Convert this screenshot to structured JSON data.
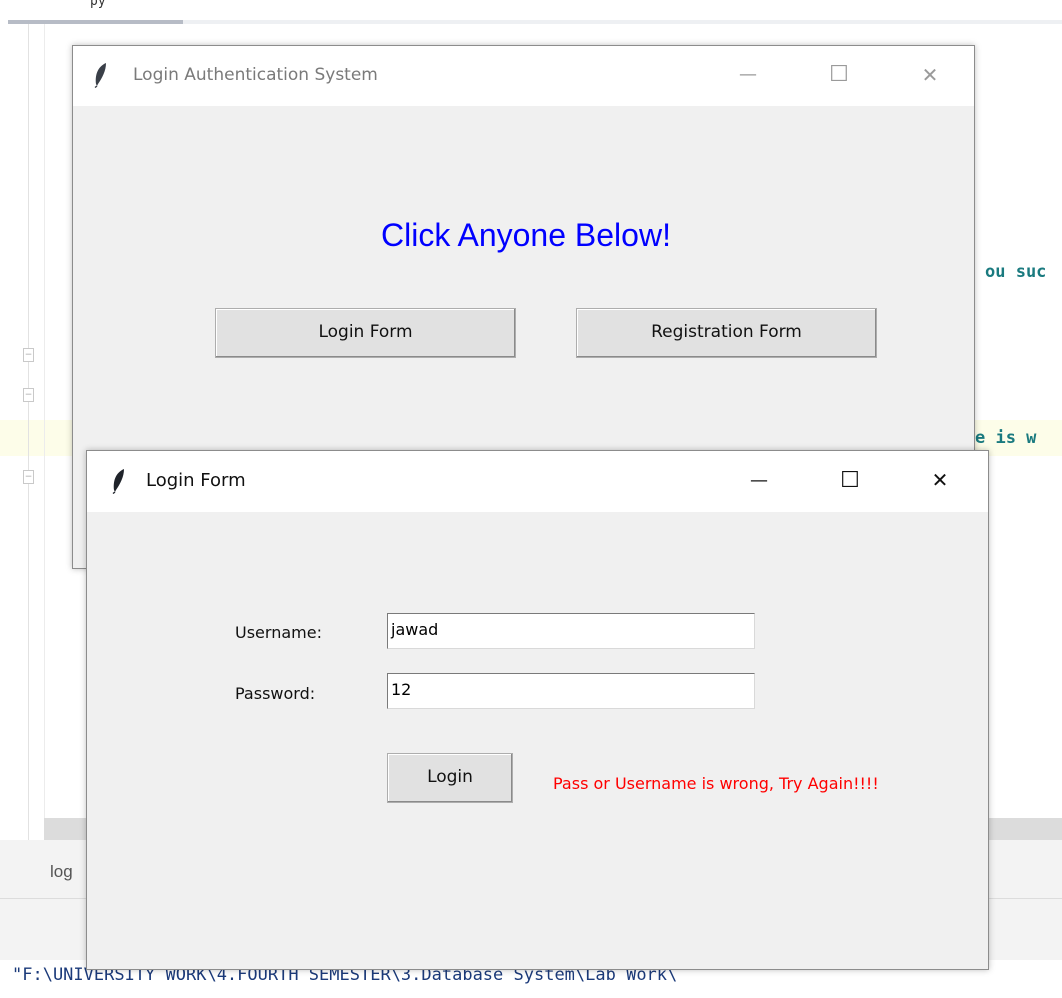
{
  "ide": {
    "tab_stub": "py",
    "code_line_1": "ou suc",
    "code_line_2": "e is w",
    "panel_tab": "log",
    "console_text": "\"F:\\UNIVERSITY WORK\\4.FOURTH SEMESTER\\3.Database System\\Lab Work\\"
  },
  "main_window": {
    "title": "Login Authentication System",
    "heading": "Click Anyone Below!",
    "heading_color": "#0000ff",
    "buttons": {
      "login": "Login Form",
      "register": "Registration Form"
    },
    "controls": {
      "minimize": "—",
      "maximize": "☐",
      "close": "✕"
    }
  },
  "login_window": {
    "title": "Login Form",
    "username_label": "Username:",
    "password_label": "Password:",
    "username_value": "jawad",
    "password_value": "12",
    "login_button": "Login",
    "error_message": "Pass or Username is wrong, Try Again!!!!",
    "error_color": "#ff0000",
    "controls": {
      "minimize": "—",
      "maximize": "☐",
      "close": "✕"
    }
  }
}
